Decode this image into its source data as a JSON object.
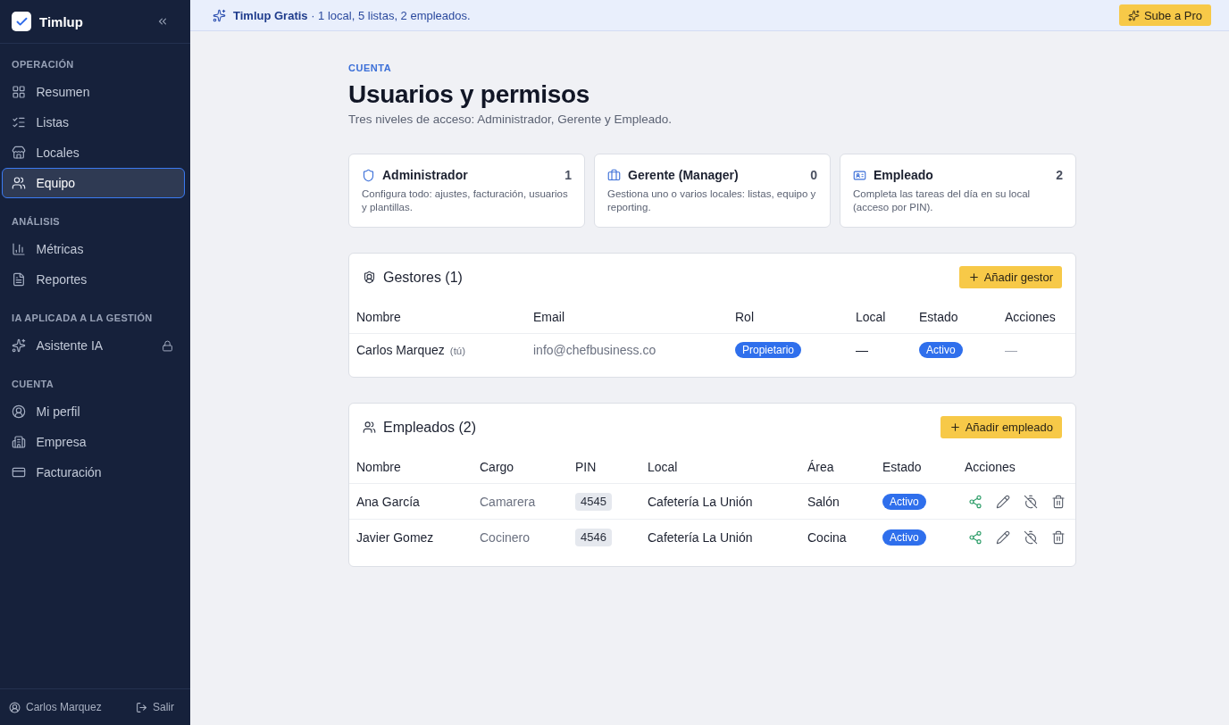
{
  "sidebar": {
    "brand": "Timlup",
    "sections": [
      {
        "title": "OPERACIÓN",
        "items": [
          {
            "label": "Resumen",
            "selected": false,
            "locked": false
          },
          {
            "label": "Listas",
            "selected": false,
            "locked": false
          },
          {
            "label": "Locales",
            "selected": false,
            "locked": false
          },
          {
            "label": "Equipo",
            "selected": true,
            "locked": false
          }
        ]
      },
      {
        "title": "ANÁLISIS",
        "items": [
          {
            "label": "Métricas",
            "selected": false,
            "locked": false
          },
          {
            "label": "Reportes",
            "selected": false,
            "locked": false
          }
        ]
      },
      {
        "title": "IA APLICADA A LA GESTIÓN",
        "items": [
          {
            "label": "Asistente IA",
            "selected": false,
            "locked": true
          }
        ]
      },
      {
        "title": "CUENTA",
        "items": [
          {
            "label": "Mi perfil",
            "selected": false,
            "locked": false
          },
          {
            "label": "Empresa",
            "selected": false,
            "locked": false
          },
          {
            "label": "Facturación",
            "selected": false,
            "locked": false
          }
        ]
      }
    ],
    "user_name": "Carlos Marquez",
    "logout": "Salir"
  },
  "banner": {
    "text": "**Timlup Gratis** · 1 local, 5 listas, 2 empleados.",
    "upgrade_button": "Sube a Pro"
  },
  "header": {
    "eyebrow": "CUENTA",
    "title": "Usuarios y permisos",
    "subtitle": "Tres niveles de acceso: Administrador, Gerente y Empleado."
  },
  "roles": [
    {
      "name": "Administrador",
      "count": "1",
      "description": "Configura todo: ajustes, facturación, usuarios y plantillas."
    },
    {
      "name": "Gerente (Manager)",
      "count": "0",
      "description": "Gestiona uno o varios locales: listas, equipo y reporting."
    },
    {
      "name": "Empleado",
      "count": "2",
      "description": "Completa las tareas del día en su local (acceso por PIN)."
    }
  ],
  "managers": {
    "title": "Gestores (1)",
    "add_button": "Añadir gestor",
    "columns": [
      "Nombre",
      "Email",
      "Rol",
      "Local",
      "Estado",
      "Acciones"
    ],
    "rows": [
      {
        "name": "Carlos Marquez",
        "you_tag": "(tú)",
        "email": "info@chefbusiness.co",
        "role": "Propietario",
        "local": "—",
        "status": "Activo",
        "actions": "—"
      }
    ]
  },
  "employees": {
    "title": "Empleados (2)",
    "add_button": "Añadir empleado",
    "columns": [
      "Nombre",
      "Cargo",
      "PIN",
      "Local",
      "Área",
      "Estado",
      "Acciones"
    ],
    "rows": [
      {
        "name": "Ana García",
        "position": "Camarera",
        "pin": "4545",
        "local": "Cafetería La Unión",
        "area": "Salón",
        "status": "Activo"
      },
      {
        "name": "Javier Gomez",
        "position": "Cocinero",
        "pin": "4546",
        "local": "Cafetería La Unión",
        "area": "Cocina",
        "status": "Activo"
      }
    ]
  }
}
